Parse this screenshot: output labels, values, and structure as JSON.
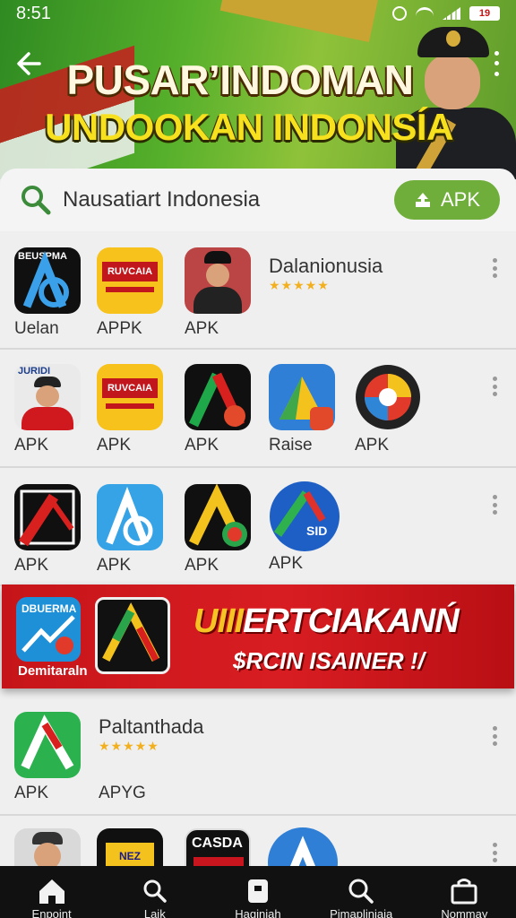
{
  "status": {
    "time": "8:51",
    "battery": "19"
  },
  "hero": {
    "title_line1": "PUSAR’INDOMAN",
    "title_line2": "UNDOOKAN INDONSÍA"
  },
  "search": {
    "text": "Nausatiart Indonesia",
    "apk_button": "APK"
  },
  "rows": [
    {
      "apps": [
        {
          "label": "Uelan",
          "icon_text": "BEUSPMA"
        },
        {
          "label": "APPK",
          "icon_text": "RUVCAIA"
        },
        {
          "label": "APK"
        }
      ],
      "title": "Dalanionusia",
      "rating": "★★★★★"
    },
    {
      "apps": [
        {
          "label": "APK",
          "icon_text": "JURIDI"
        },
        {
          "label": "APK",
          "icon_text": "RUVCAIA"
        },
        {
          "label": "APK"
        },
        {
          "label": "Raise"
        },
        {
          "label": "APK"
        }
      ]
    },
    {
      "apps": [
        {
          "label": "APK"
        },
        {
          "label": "APK"
        },
        {
          "label": "APK"
        },
        {
          "label": "APK",
          "icon_text": "SID"
        }
      ]
    }
  ],
  "promo": {
    "icon_text": "DBUERMA",
    "caption": "Demitaraln",
    "headline_part1": "UIII",
    "headline_part2": "ERTCIAKANŃ",
    "subline": "$RCIN ISAINER !/"
  },
  "row4": {
    "title": "Paltanthada",
    "rating": "★★★★★",
    "apps": [
      {
        "label": "APK"
      },
      {
        "label": "APYG"
      }
    ]
  },
  "row5": {
    "icon_text_a": "CASDA",
    "icon_text_b": "NEZ"
  },
  "bottom_nav": [
    "Enpoint",
    "Laik",
    "Haginiah",
    "Pimapliniaia",
    "Nommay"
  ]
}
